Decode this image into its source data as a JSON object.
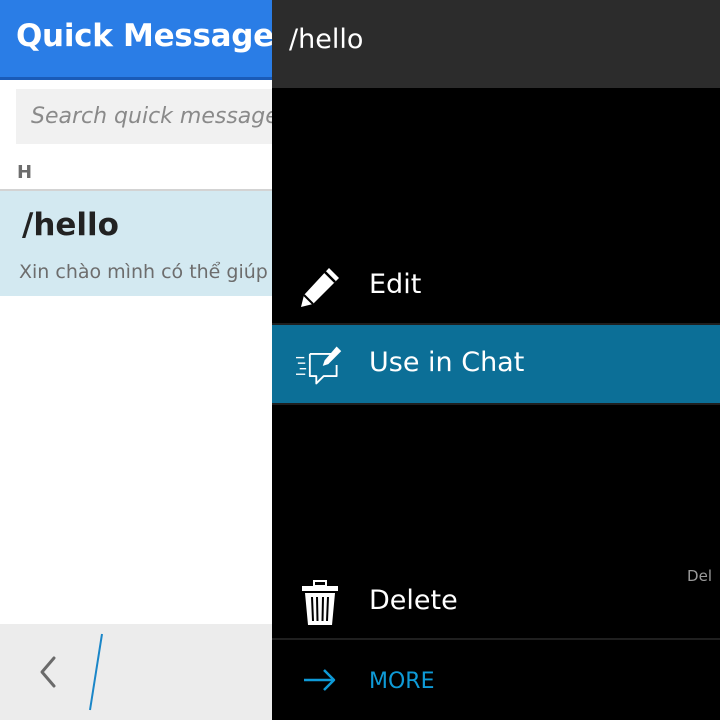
{
  "app": {
    "title": "Quick Message",
    "search_placeholder": "Search quick messages"
  },
  "list": {
    "section_header": "H",
    "items": [
      {
        "title": "/hello",
        "description": "Xin chào mình có thể giúp gì cho bạn"
      }
    ]
  },
  "menu": {
    "title": "/hello",
    "items": [
      {
        "label": "Edit",
        "icon": "pencil-icon"
      },
      {
        "label": "Use in Chat",
        "icon": "chat-bubble-edit-icon",
        "selected": true
      },
      {
        "label": "Delete",
        "icon": "trash-icon",
        "shortcut": "Del"
      }
    ],
    "more_label": "MORE",
    "more_icon": "arrow-right-icon"
  },
  "bottom_bar": {
    "back_icon": "chevron-left-icon"
  },
  "colors": {
    "app_bar": "#2a7de6",
    "selected_row": "#d3e9f1",
    "menu_selected": "#0c6f97",
    "more_accent": "#0e9ad7"
  }
}
